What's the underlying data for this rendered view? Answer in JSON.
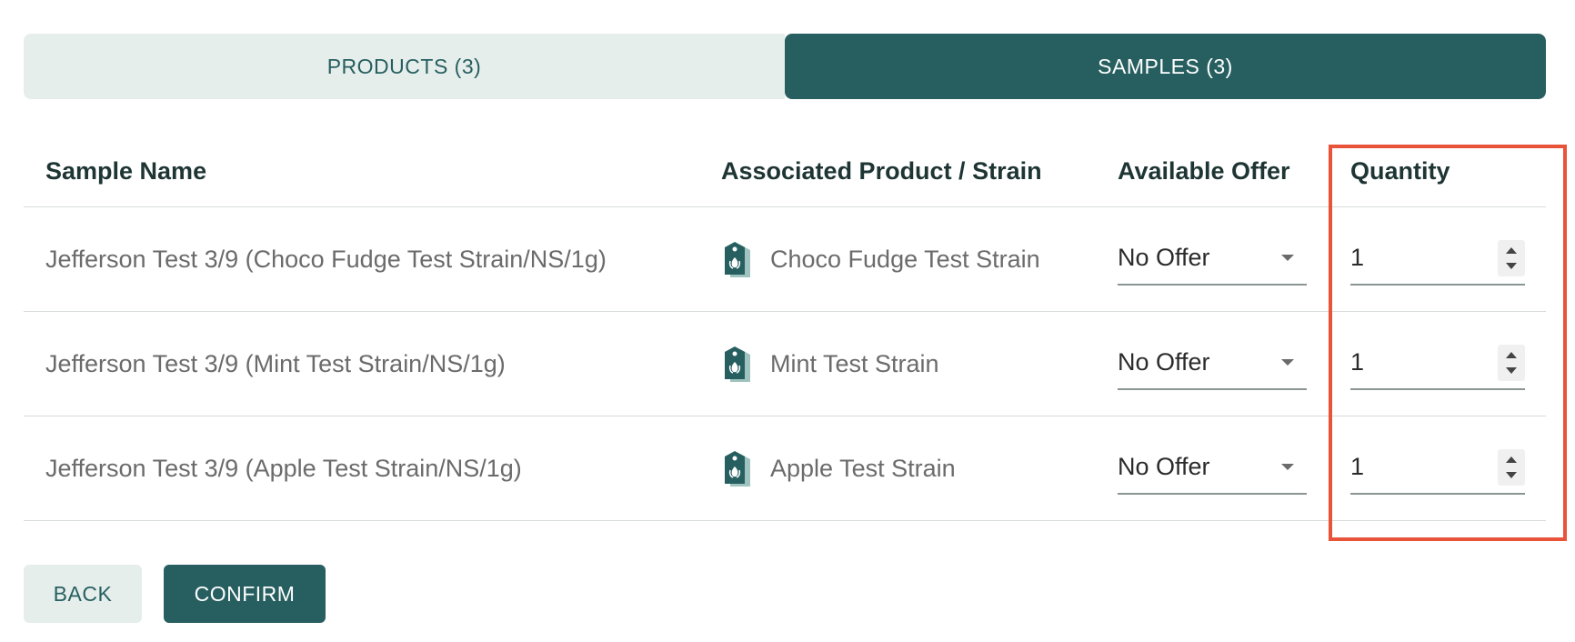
{
  "tabs": [
    {
      "label": "PRODUCTS (3)",
      "active": false
    },
    {
      "label": "SAMPLES (3)",
      "active": true
    }
  ],
  "table": {
    "headers": {
      "sample_name": "Sample Name",
      "product": "Associated Product / Strain",
      "offer": "Available Offer",
      "quantity": "Quantity"
    },
    "rows": [
      {
        "sample_name": "Jefferson Test 3/9 (Choco Fudge Test Strain/NS/1g)",
        "product": "Choco Fudge Test Strain",
        "offer": "No Offer",
        "quantity": "1"
      },
      {
        "sample_name": "Jefferson Test 3/9 (Mint Test Strain/NS/1g)",
        "product": "Mint Test Strain",
        "offer": "No Offer",
        "quantity": "1"
      },
      {
        "sample_name": "Jefferson Test 3/9 (Apple Test Strain/NS/1g)",
        "product": "Apple Test Strain",
        "offer": "No Offer",
        "quantity": "1"
      }
    ]
  },
  "buttons": {
    "back": "BACK",
    "confirm": "CONFIRM"
  },
  "icons": {
    "product": "product-tag-icon",
    "offer_dropdown": "chevron-down-icon",
    "stepper": "stepper-icon"
  },
  "colors": {
    "brand": "#275f60",
    "brand_light": "#e6eeec",
    "highlight": "#e8533a"
  }
}
